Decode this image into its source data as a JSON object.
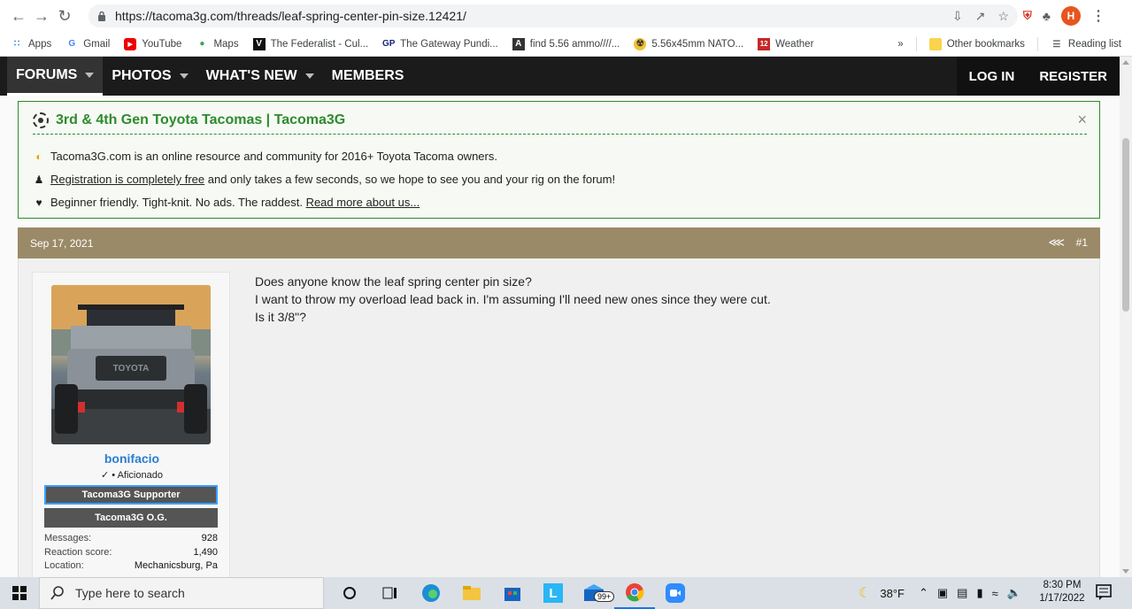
{
  "browser": {
    "url": "https://tacoma3g.com/threads/leaf-spring-center-pin-size.12421/",
    "profile_initial": "H",
    "bookmarks": [
      {
        "label": "Apps",
        "icon": "apps-grid-icon"
      },
      {
        "label": "Gmail",
        "icon": "google-icon"
      },
      {
        "label": "YouTube",
        "icon": "youtube-icon"
      },
      {
        "label": "Maps",
        "icon": "maps-icon"
      },
      {
        "label": "The Federalist - Cul...",
        "icon": "federalist-icon"
      },
      {
        "label": "The Gateway Pundi...",
        "icon": "gateway-pundit-icon"
      },
      {
        "label": "find 5.56 ammo////...",
        "icon": "ammo-icon"
      },
      {
        "label": "5.56x45mm NATO...",
        "icon": "nato-icon"
      },
      {
        "label": "Weather",
        "icon": "weather-icon"
      }
    ],
    "more_bookmarks": "»",
    "other_bookmarks": "Other bookmarks",
    "reading_list": "Reading list"
  },
  "forum_nav": {
    "items": [
      {
        "label": "FORUMS",
        "has_caret": true,
        "active": true
      },
      {
        "label": "PHOTOS",
        "has_caret": true,
        "active": false
      },
      {
        "label": "WHAT'S NEW",
        "has_caret": true,
        "active": false
      },
      {
        "label": "MEMBERS",
        "has_caret": false,
        "active": false
      }
    ],
    "login": "LOG IN",
    "register": "REGISTER"
  },
  "notice": {
    "title": "3rd & 4th Gen Toyota Tacomas | Tacoma3G",
    "close": "×",
    "line1": "Tacoma3G.com is an online resource and community for 2016+ Toyota Tacoma owners.",
    "line2_link": "Registration is completely free",
    "line2_rest": " and only takes a few seconds, so we hope to see you and your rig on the forum!",
    "line3_text": "Beginner friendly. Tight-knit. No ads. The raddest. ",
    "line3_link": "Read more about us..."
  },
  "post": {
    "date": "Sep 17, 2021",
    "number": "#1",
    "username": "bonifacio",
    "user_title": "✓ • Aficionado",
    "banners": [
      "Tacoma3G Supporter",
      "Tacoma3G O.G."
    ],
    "stats": [
      {
        "label": "Messages:",
        "value": "928"
      },
      {
        "label": "Reaction score:",
        "value": "1,490"
      },
      {
        "label": "Location:",
        "value": "Mechanicsburg, Pa"
      }
    ],
    "body": [
      "Does anyone know the leaf spring center pin size?",
      "I want to throw my overload lead back in. I'm assuming I'll need new ones since they were cut.",
      "Is it 3/8\"?"
    ]
  },
  "taskbar": {
    "search_placeholder": "Type here to search",
    "mail_badge": "99+",
    "temperature": "38°F",
    "time": "8:30 PM",
    "date": "1/17/2022"
  },
  "colors": {
    "forum_nav_bg": "#1b1b1b",
    "notice_green": "#2e8b2e",
    "post_header": "#9b8a68",
    "username_blue": "#2a7ed0"
  }
}
